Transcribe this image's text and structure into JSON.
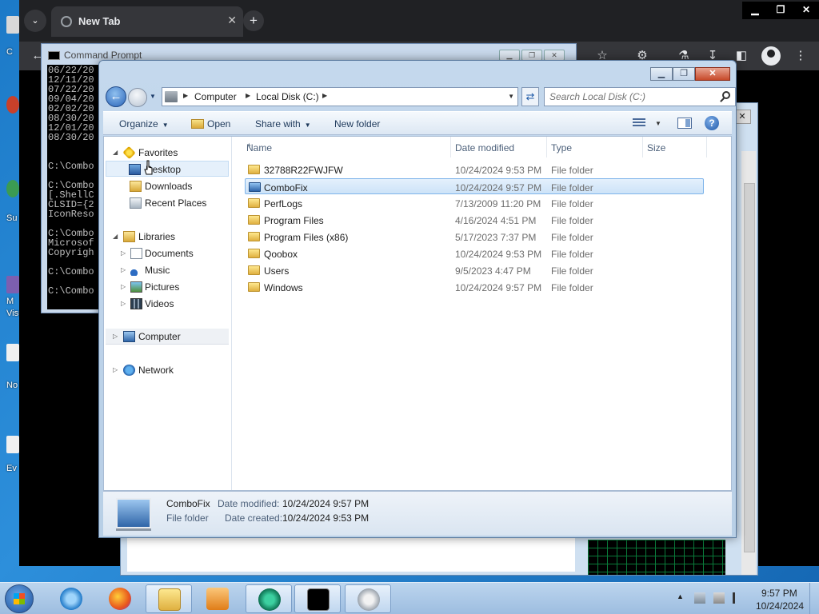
{
  "desktop": {
    "labels": [
      "C",
      "Su",
      "M",
      "Visu",
      "No",
      "Ev"
    ]
  },
  "chrome": {
    "tab_title": "New Tab",
    "tab_close": "✕",
    "new_tab": "+",
    "tab_search": "⌄",
    "window_controls": [
      "▁",
      "❐",
      "✕"
    ]
  },
  "cmd_window": {
    "title": "Command Prompt",
    "controls": [
      "▁",
      "❐",
      "✕"
    ],
    "lines": [
      "06/22/20",
      "12/11/20",
      "07/22/20",
      "09/04/20",
      "02/02/20",
      "08/30/20",
      "12/01/20",
      "08/30/20",
      "",
      "",
      "C:\\Combo",
      "",
      "C:\\Combo",
      "[.ShellC",
      "CLSID={2",
      "IconReso",
      "",
      "C:\\Combo",
      "Microsof",
      "Copyrigh",
      "",
      "C:\\Combo",
      "",
      "C:\\Combo"
    ]
  },
  "explorer": {
    "breadcrumb": [
      "Computer",
      "Local Disk (C:)"
    ],
    "search_placeholder": "Search Local Disk (C:)",
    "toolbar": {
      "organize": "Organize",
      "open": "Open",
      "share_with": "Share with",
      "new_folder": "New folder"
    },
    "nav": {
      "favorites": "Favorites",
      "desktop": "Desktop",
      "downloads": "Downloads",
      "recent_places": "Recent Places",
      "libraries": "Libraries",
      "documents": "Documents",
      "music": "Music",
      "pictures": "Pictures",
      "videos": "Videos",
      "computer": "Computer",
      "network": "Network"
    },
    "columns": [
      "Name",
      "Date modified",
      "Type",
      "Size"
    ],
    "files": [
      {
        "name": "32788R22FWJFW",
        "date": "10/24/2024 9:53 PM",
        "type": "File folder"
      },
      {
        "name": "ComboFix",
        "date": "10/24/2024 9:57 PM",
        "type": "File folder"
      },
      {
        "name": "PerfLogs",
        "date": "7/13/2009 11:20 PM",
        "type": "File folder"
      },
      {
        "name": "Program Files",
        "date": "4/16/2024 4:51 PM",
        "type": "File folder"
      },
      {
        "name": "Program Files (x86)",
        "date": "5/17/2023 7:37 PM",
        "type": "File folder"
      },
      {
        "name": "Qoobox",
        "date": "10/24/2024 9:53 PM",
        "type": "File folder"
      },
      {
        "name": "Users",
        "date": "9/5/2023 4:47 PM",
        "type": "File folder"
      },
      {
        "name": "Windows",
        "date": "10/24/2024 9:57 PM",
        "type": "File folder"
      }
    ],
    "details": {
      "name": "ComboFix",
      "type": "File folder",
      "modified_label": "Date modified:",
      "modified_value": "10/24/2024 9:57 PM",
      "created_label": "Date created:",
      "created_value": "10/24/2024 9:53 PM"
    }
  },
  "taskbar": {
    "time": "9:57 PM",
    "date": "10/24/2024"
  }
}
